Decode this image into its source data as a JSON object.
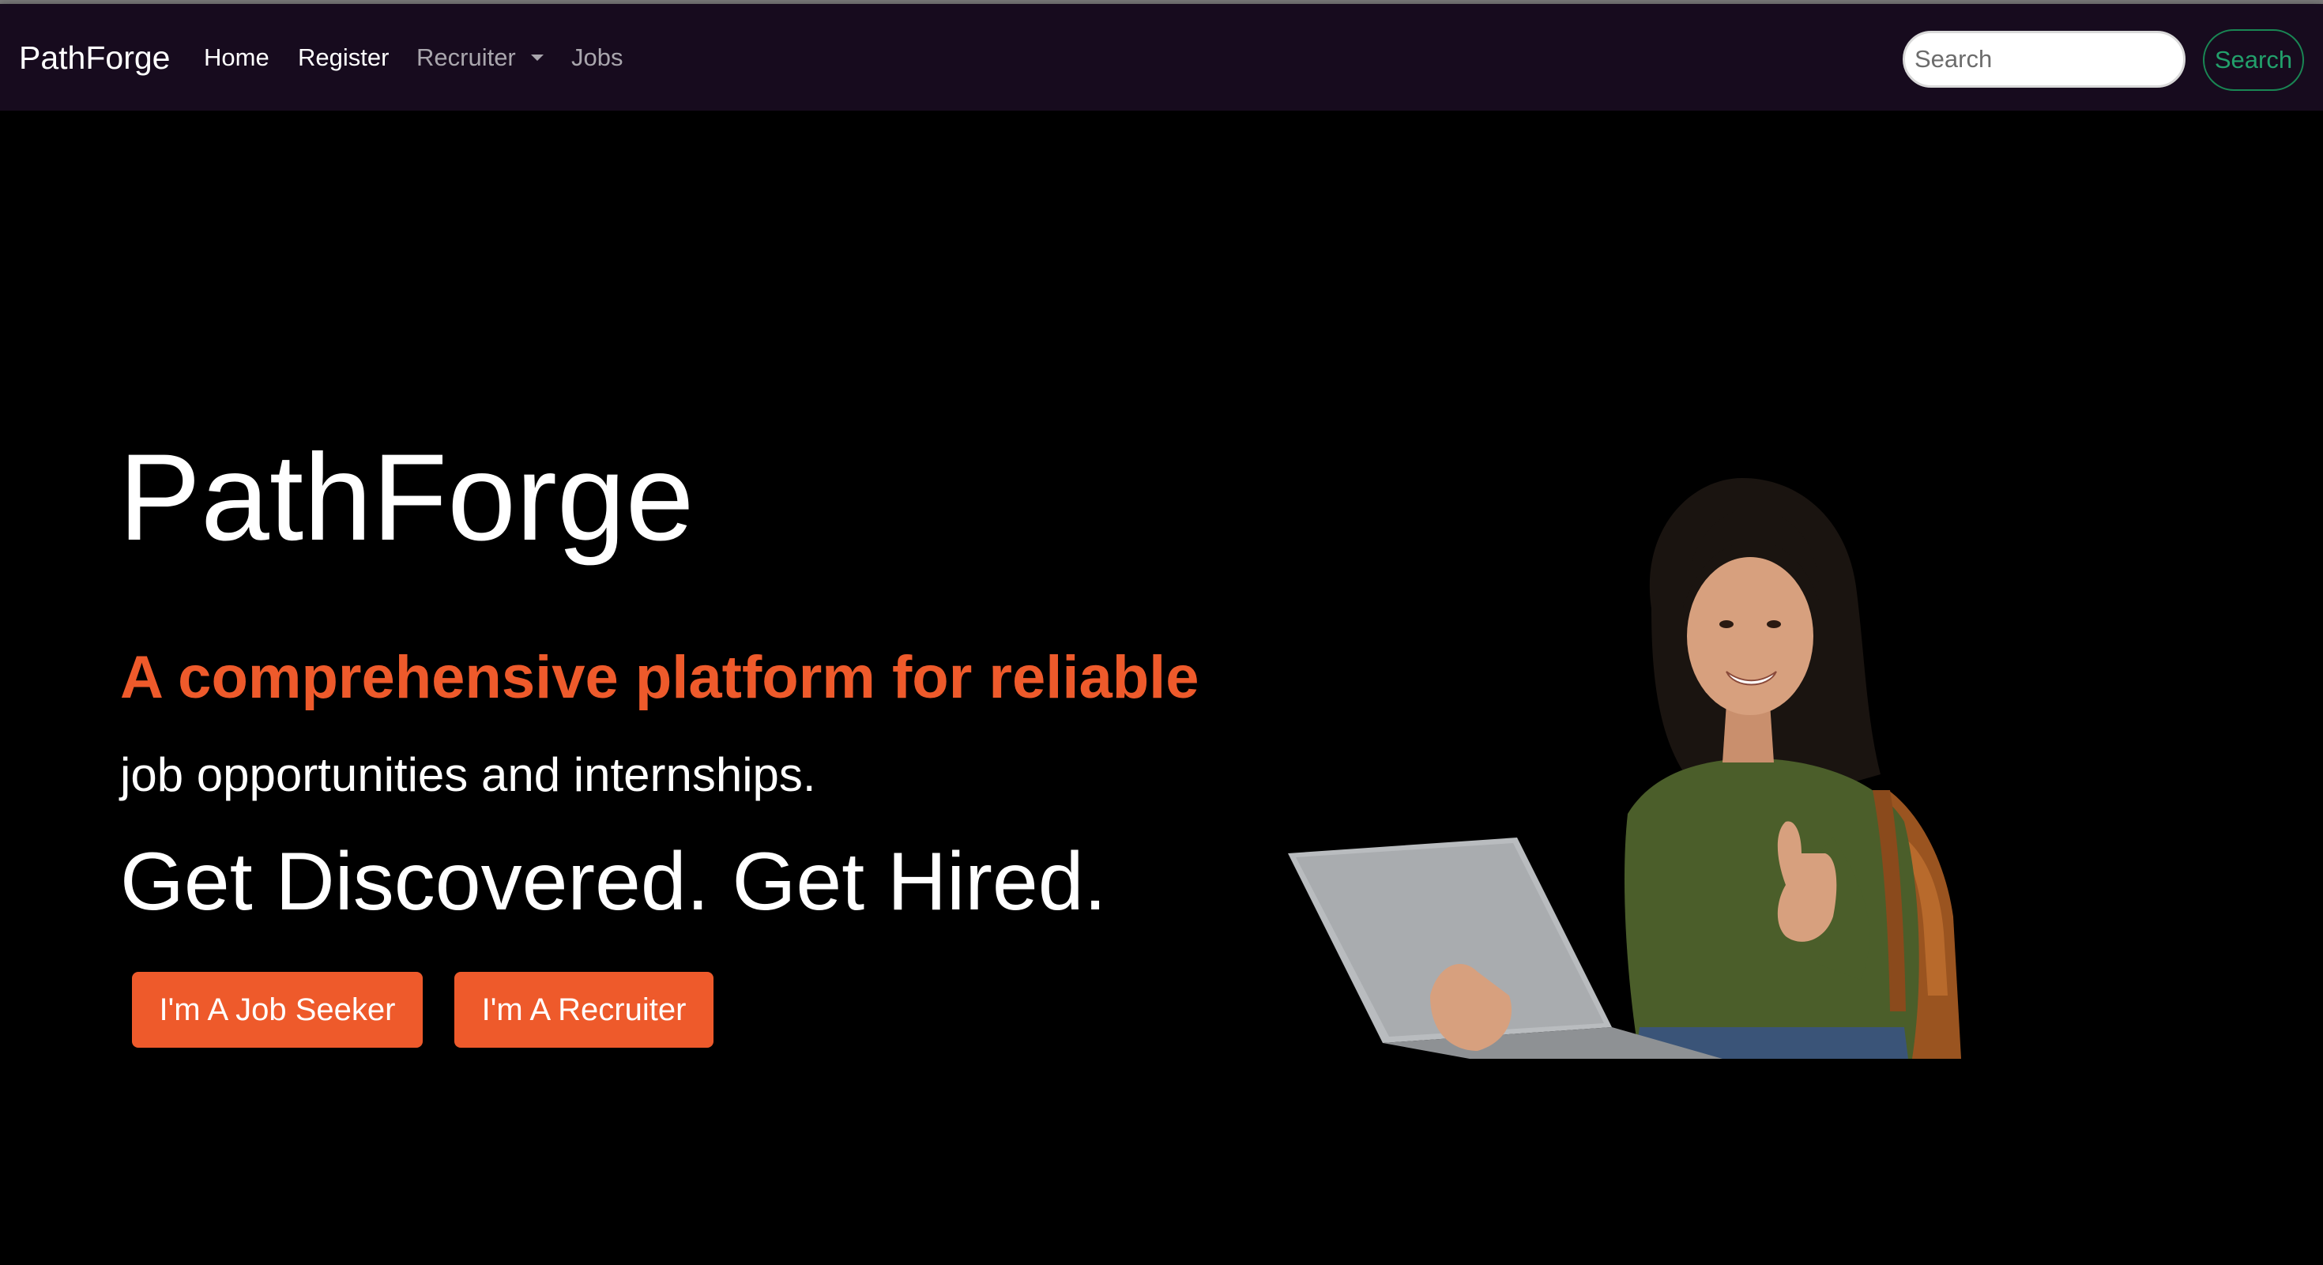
{
  "navbar": {
    "brand": "PathForge",
    "links": {
      "home": "Home",
      "register": "Register",
      "recruiter": "Recruiter",
      "jobs": "Jobs"
    },
    "search": {
      "placeholder": "Search",
      "value": "",
      "button_label": "Search"
    }
  },
  "hero": {
    "title": "PathForge",
    "tagline": "A comprehensive platform for reliable",
    "subtitle": "job opportunities and internships.",
    "slogan": "Get Discovered. Get Hired.",
    "buttons": {
      "job_seeker": "I'm A Job Seeker",
      "recruiter": "I'm A Recruiter"
    },
    "image": "smiling woman with laptop giving thumbs up"
  },
  "colors": {
    "navbar_bg": "#170b1e",
    "page_bg": "#000000",
    "accent": "#ee5a2b",
    "search_button": "#198754"
  }
}
